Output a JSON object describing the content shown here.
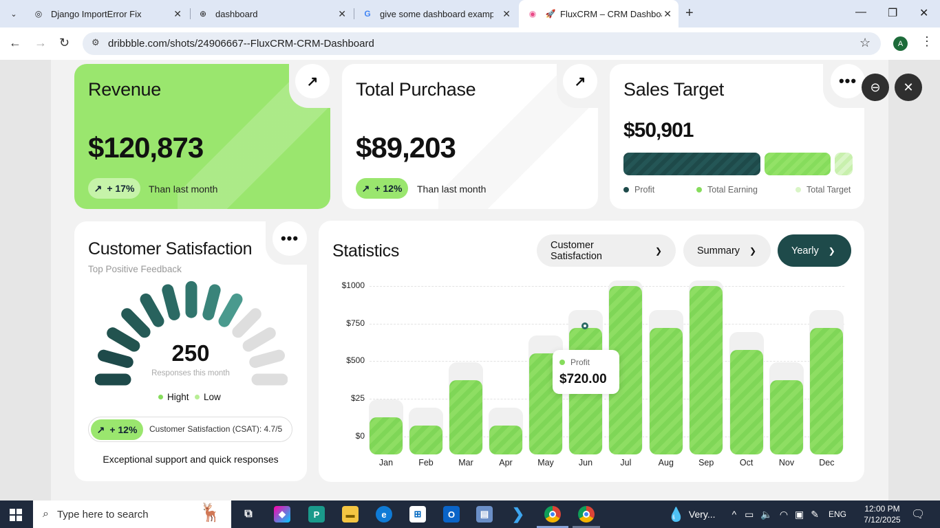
{
  "browser": {
    "tabs": [
      {
        "title": "Django ImportError Fix",
        "icon": "openai-icon"
      },
      {
        "title": "dashboard",
        "icon": "globe-icon"
      },
      {
        "title": "give some dashboard example i",
        "icon": "google-icon"
      },
      {
        "title": "FluxCRM – CRM Dashboard",
        "icon": "dribbble-icon"
      }
    ],
    "url": "dribbble.com/shots/24906667--FluxCRM-CRM-Dashboard",
    "profile_initial": "A"
  },
  "dashboard": {
    "revenue": {
      "title": "Revenue",
      "value": "$120,873",
      "change": "+ 17%",
      "note": "Than last month"
    },
    "purchase": {
      "title": "Total Purchase",
      "value": "$89,203",
      "change": "+ 12%",
      "note": "Than last month"
    },
    "sales_target": {
      "title": "Sales Target",
      "value": "$50,901",
      "legend": [
        "Profit",
        "Total Earning",
        "Total Target"
      ],
      "segments": {
        "profit": 0.6,
        "earning": 0.29,
        "target": 0.08
      }
    },
    "satisfaction": {
      "title": "Customer Satisfaction",
      "subtitle": "Top Positive Feedback",
      "value": "250",
      "value_caption": "Responses this month",
      "legend": [
        "Hight",
        "Low"
      ],
      "change": "+ 12%",
      "csat": "Customer Satisfaction (CSAT): 4.7/5",
      "footer": "Exceptional support and quick responses",
      "gauge_segments_total": 13,
      "gauge_segments_high": 9
    },
    "statistics": {
      "title": "Statistics",
      "filters": [
        "Customer Satisfaction",
        "Summary",
        "Yearly"
      ],
      "tooltip": {
        "label": "Profit",
        "value": "$720.00"
      }
    },
    "colors": {
      "accent_green": "#9ae66e",
      "dark_teal": "#1e4a4a",
      "bar_green": "#82d95a"
    }
  },
  "chart_data": {
    "type": "bar",
    "categories": [
      "Jan",
      "Feb",
      "Mar",
      "Apr",
      "May",
      "Jun",
      "Jul",
      "Aug",
      "Sep",
      "Oct",
      "Nov",
      "Dec"
    ],
    "y_ticks": [
      "$1000",
      "$750",
      "$500",
      "$25",
      "$0"
    ],
    "y_positions": [
      1000,
      750,
      500,
      250,
      0
    ],
    "values": [
      125,
      70,
      375,
      70,
      550,
      720,
      1000,
      720,
      1000,
      575,
      375,
      720
    ],
    "ylim": [
      -120,
      1000
    ],
    "highlight": {
      "category": "Jun",
      "series": "Profit",
      "value": 720
    }
  },
  "taskbar": {
    "search_placeholder": "Type here to search",
    "weather": "Very...",
    "lang": "ENG",
    "time": "12:00 PM",
    "date": "7/12/2025"
  }
}
